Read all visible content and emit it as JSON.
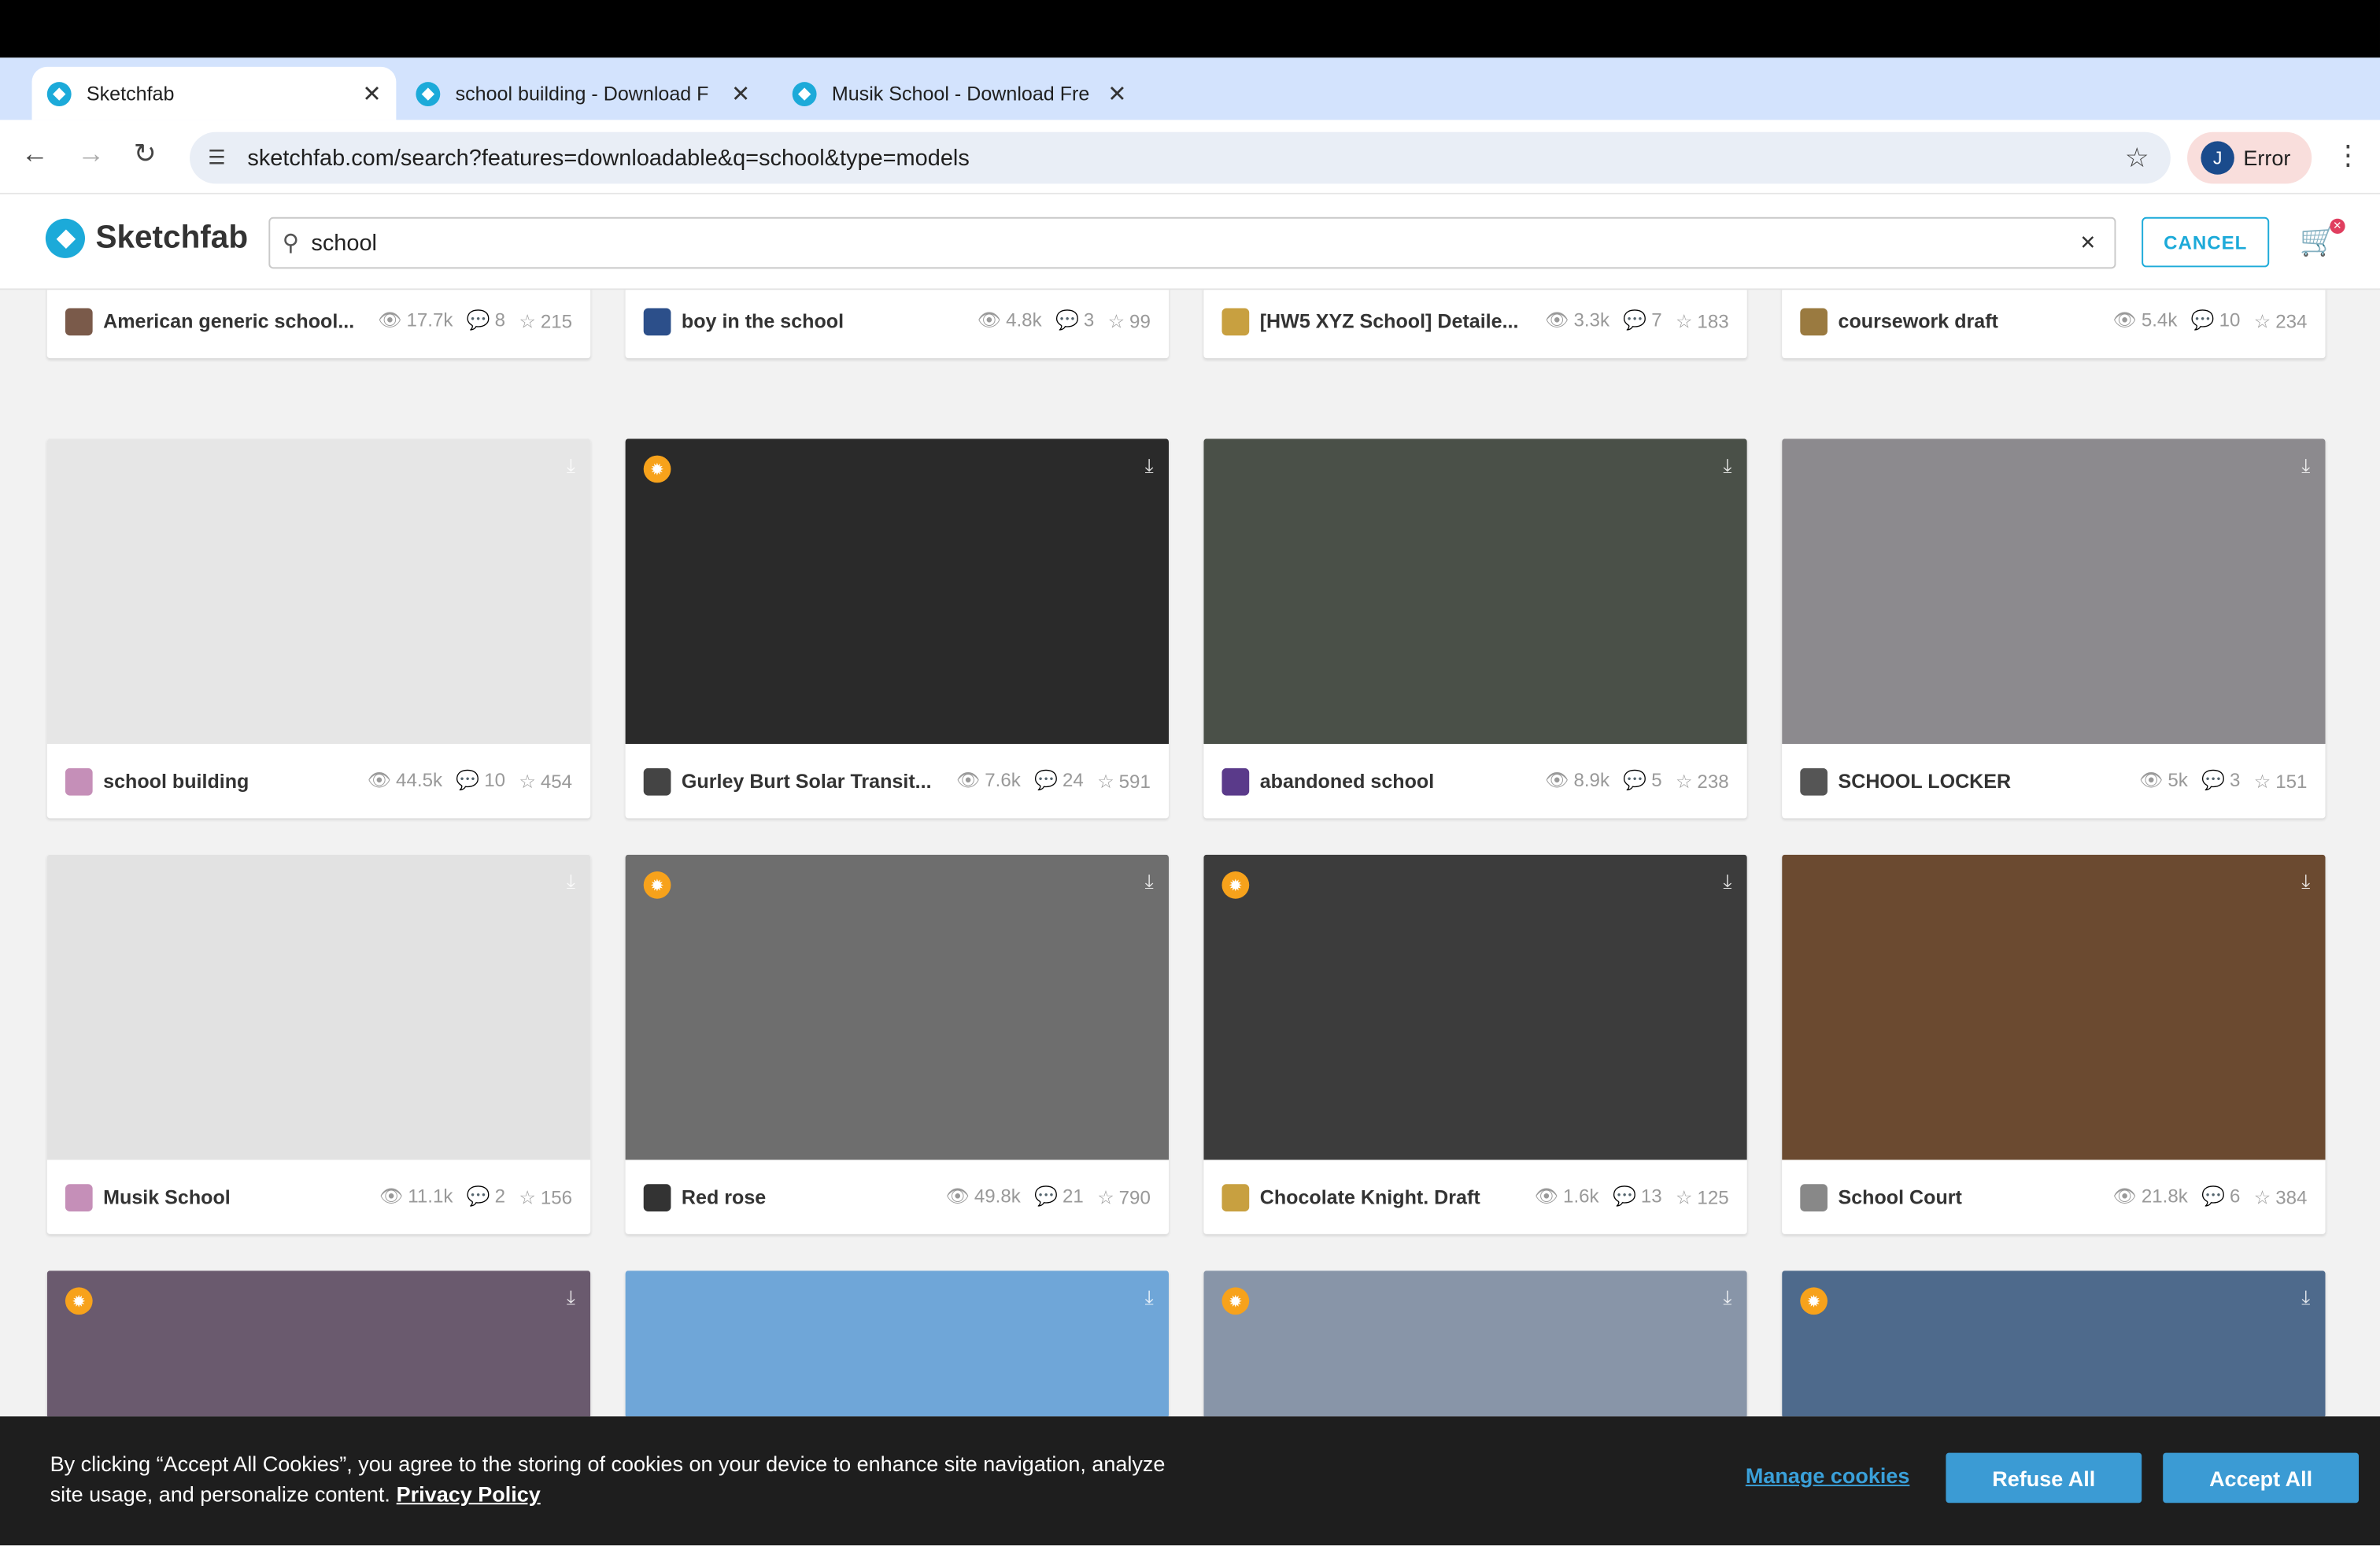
{
  "browser": {
    "tabs": [
      {
        "title": "Sketchfab",
        "active": true
      },
      {
        "title": "school building - Download F",
        "active": false
      },
      {
        "title": "Musik School - Download Fre",
        "active": false
      }
    ],
    "new_tab": "+",
    "tab_menu": "⌄",
    "url": "sketchfab.com/search?features=downloadable&q=school&type=models",
    "profile_initial": "J",
    "profile_status": "Error"
  },
  "site": {
    "logo_text": "Sketchfab",
    "search_value": "school",
    "cancel_label": "CANCEL",
    "cart_badge": "✕"
  },
  "models": [
    {
      "name": "American generic school...",
      "views": "17.7k",
      "comments": "8",
      "likes": "215",
      "thumb": "#3a3a3a",
      "avatar": "#7a5a4a",
      "staff": false
    },
    {
      "name": "boy in the school",
      "views": "4.8k",
      "comments": "3",
      "likes": "99",
      "thumb": "#b9cfd3",
      "avatar": "#2c4f8a",
      "staff": false
    },
    {
      "name": "[HW5 XYZ School] Detaile...",
      "views": "3.3k",
      "comments": "7",
      "likes": "183",
      "thumb": "#1e1e1e",
      "avatar": "#c8a040",
      "staff": false
    },
    {
      "name": "coursework draft",
      "views": "5.4k",
      "comments": "10",
      "likes": "234",
      "thumb": "#a8aebc",
      "avatar": "#9a7a40",
      "staff": false
    },
    {
      "name": "school building",
      "views": "44.5k",
      "comments": "10",
      "likes": "454",
      "thumb": "#e6e6e6",
      "avatar": "#c58fb8",
      "staff": false
    },
    {
      "name": "Gurley Burt Solar Transit...",
      "views": "7.6k",
      "comments": "24",
      "likes": "591",
      "thumb": "#2a2a2a",
      "avatar": "#444444",
      "staff": true
    },
    {
      "name": "abandoned school",
      "views": "8.9k",
      "comments": "5",
      "likes": "238",
      "thumb": "#4a5048",
      "avatar": "#5a3a8a",
      "staff": false
    },
    {
      "name": "SCHOOL LOCKER",
      "views": "5k",
      "comments": "3",
      "likes": "151",
      "thumb": "#8c8a8e",
      "avatar": "#555555",
      "staff": false
    },
    {
      "name": "Musik School",
      "views": "11.1k",
      "comments": "2",
      "likes": "156",
      "thumb": "#e2e2e2",
      "avatar": "#c58fb8",
      "staff": false
    },
    {
      "name": "Red rose",
      "views": "49.8k",
      "comments": "21",
      "likes": "790",
      "thumb": "#6e6e6e",
      "avatar": "#333333",
      "staff": true
    },
    {
      "name": "Chocolate Knight. Draft",
      "views": "1.6k",
      "comments": "13",
      "likes": "125",
      "thumb": "#3c3c3c",
      "avatar": "#c8a040",
      "staff": true
    },
    {
      "name": "School Court",
      "views": "21.8k",
      "comments": "6",
      "likes": "384",
      "thumb": "#6b4a30",
      "avatar": "#888888",
      "staff": false
    },
    {
      "thumb": "#6a5a6e",
      "staff": true
    },
    {
      "thumb": "#6fa6d8",
      "staff": false
    },
    {
      "thumb": "#8895a8",
      "staff": true
    },
    {
      "thumb": "#4e6a8c",
      "staff": true
    }
  ],
  "cookie": {
    "message": "By clicking “Accept All Cookies”, you agree to the storing of cookies on your device to enhance site navigation, analyze site usage, and personalize content.",
    "privacy_link": "Privacy Policy",
    "manage": "Manage cookies",
    "refuse": "Refuse All",
    "accept": "Accept All"
  }
}
